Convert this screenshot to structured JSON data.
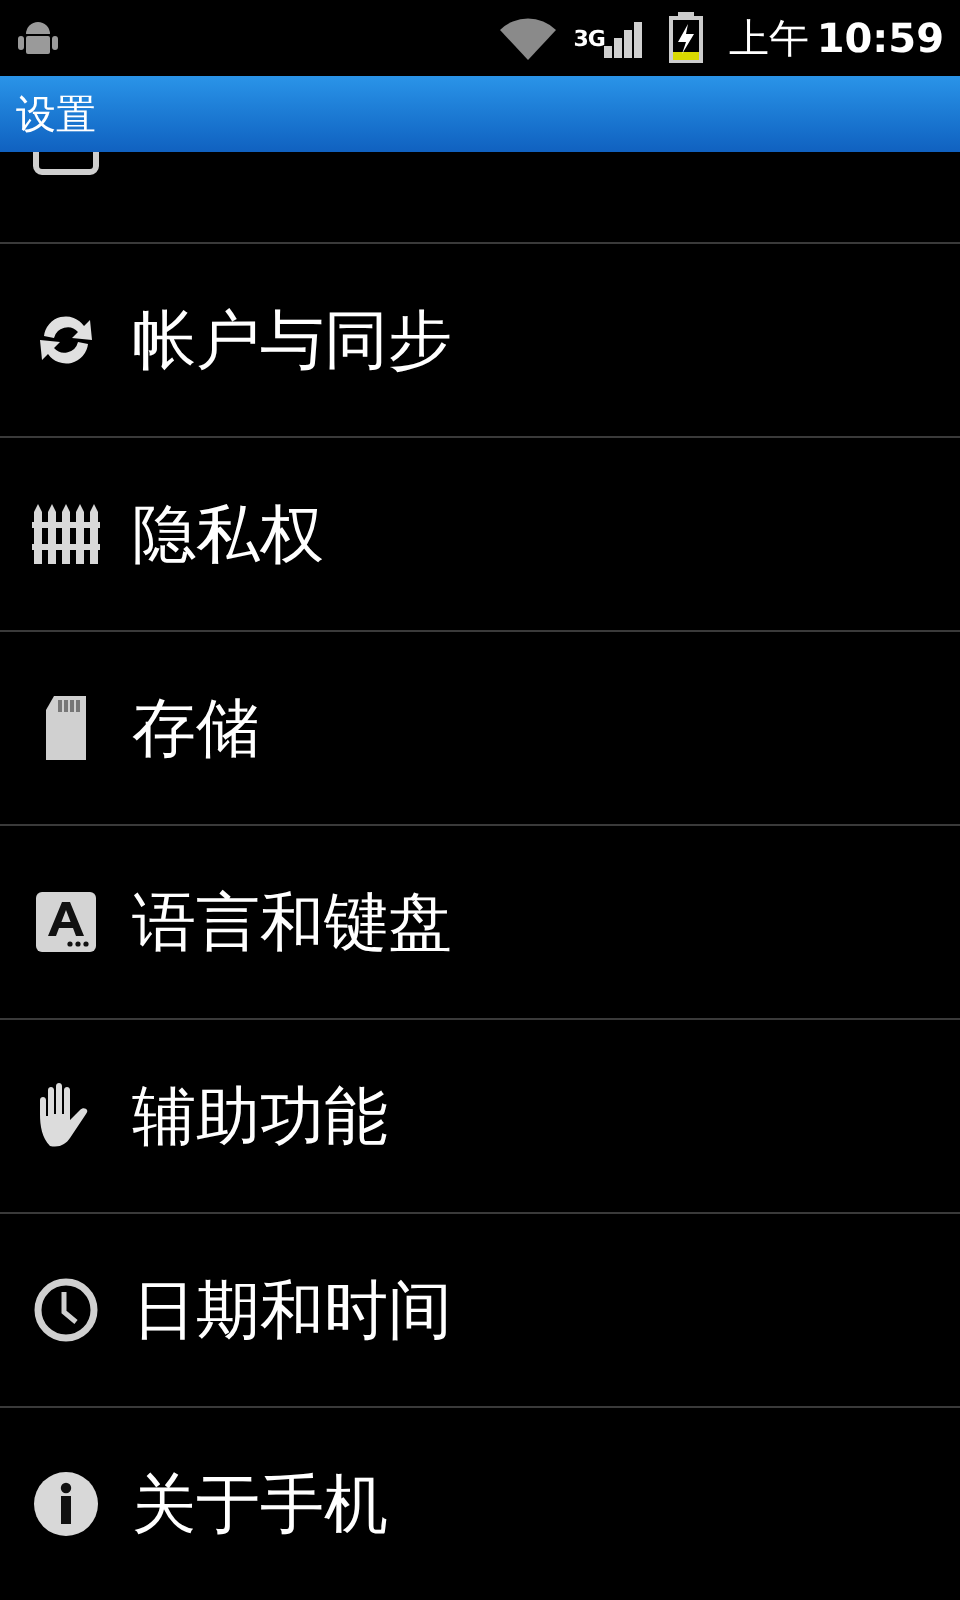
{
  "status_bar": {
    "network": "3G",
    "am_pm": "上午",
    "time": "10:59"
  },
  "title": "设置",
  "items": [
    {
      "label": "帐户与同步"
    },
    {
      "label": "隐私权"
    },
    {
      "label": "存储"
    },
    {
      "label": "语言和键盘"
    },
    {
      "label": "辅助功能"
    },
    {
      "label": "日期和时间"
    },
    {
      "label": "关于手机"
    }
  ]
}
